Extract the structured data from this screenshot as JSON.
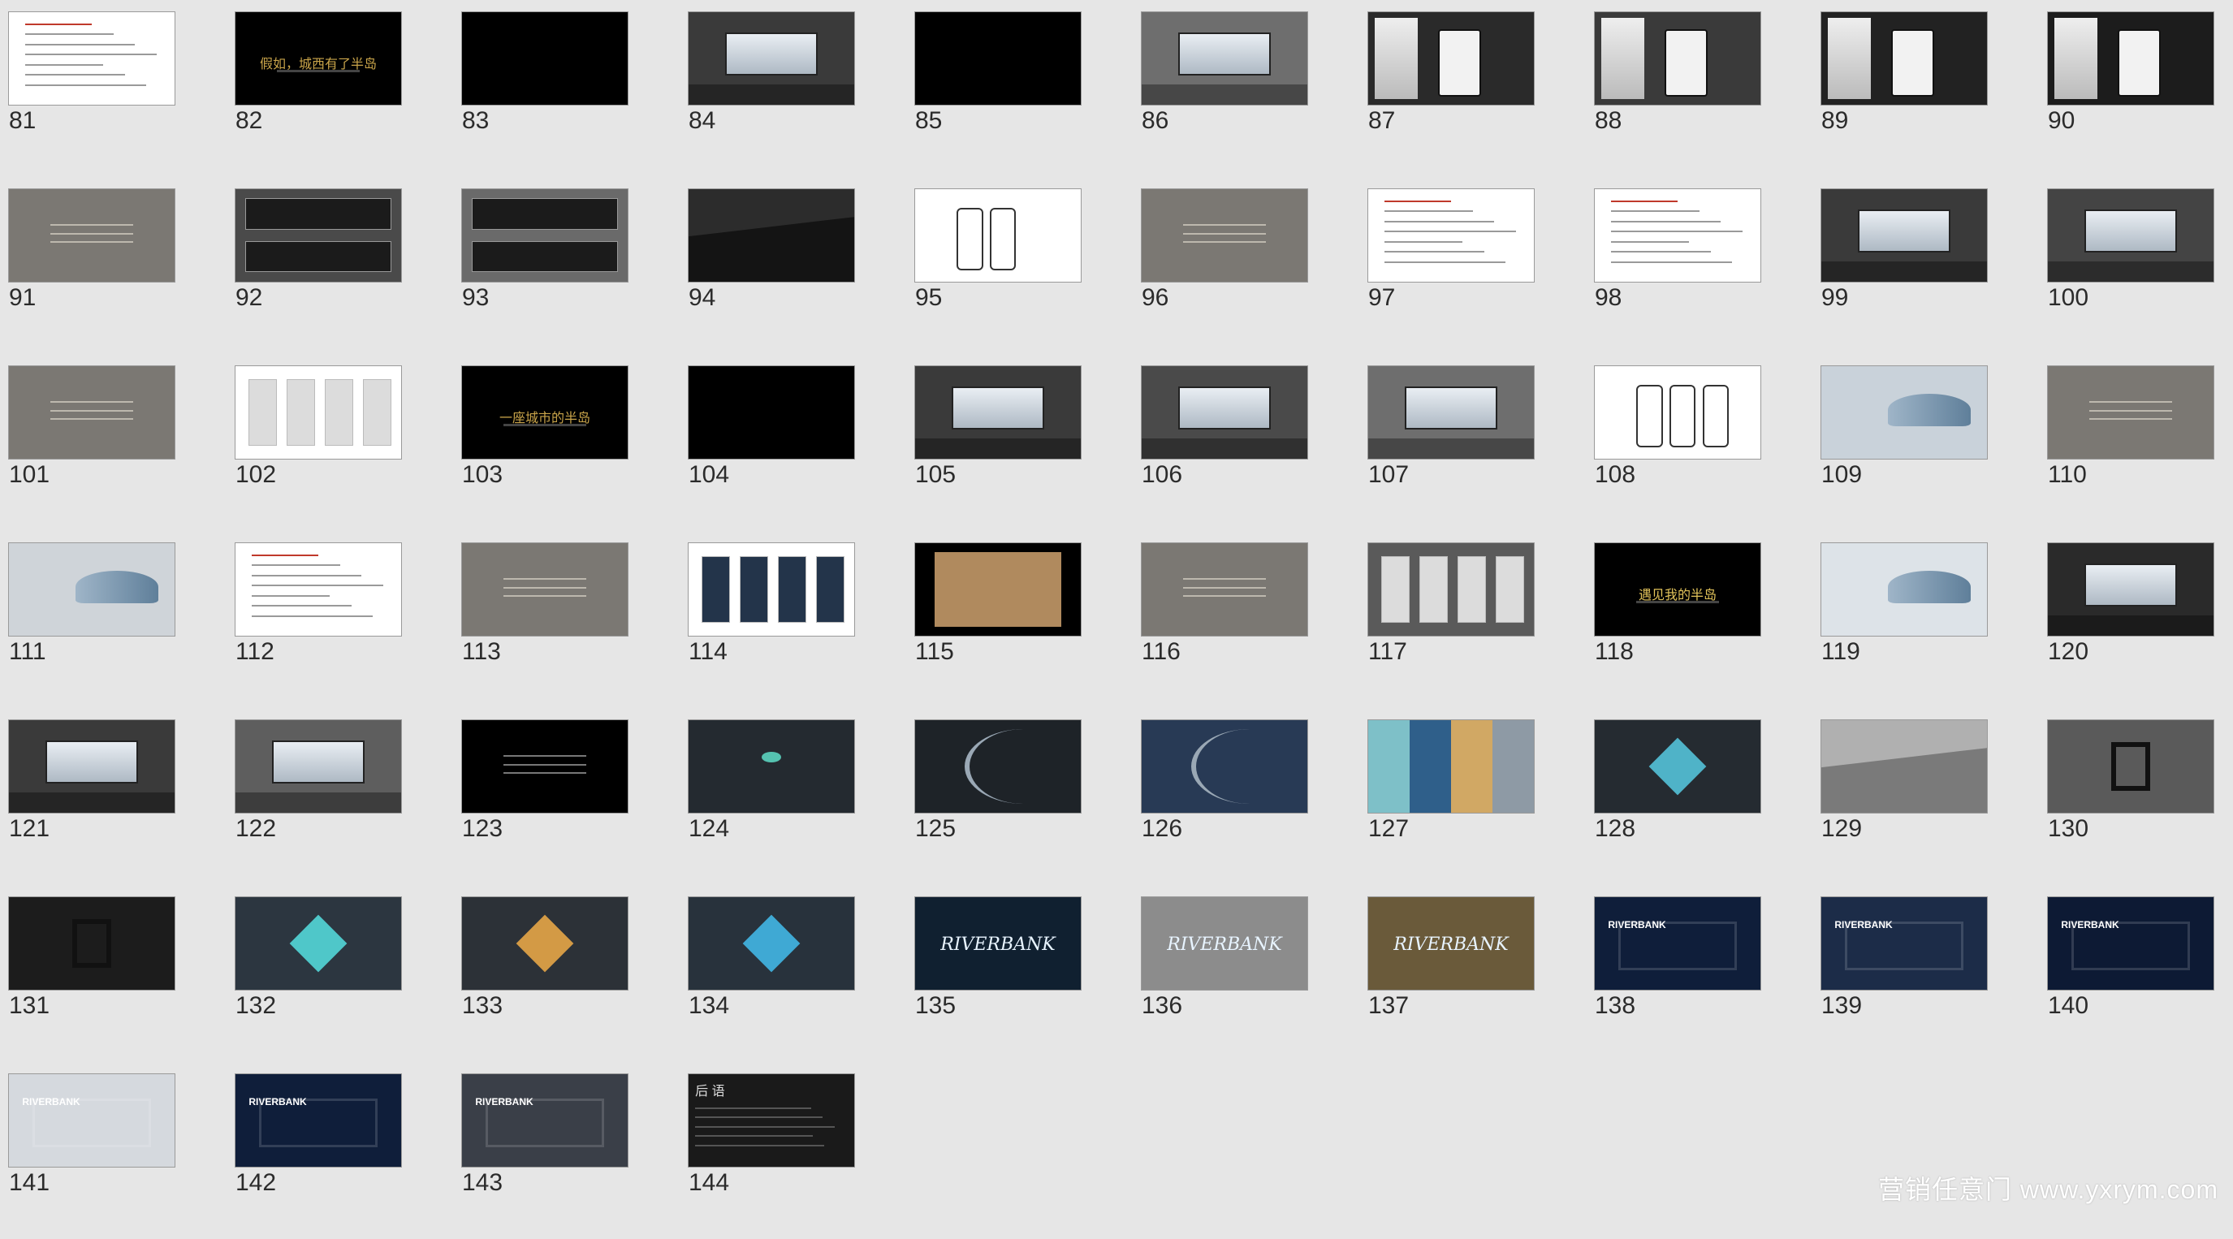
{
  "view": "slide-sorter",
  "colors": {
    "background": "#e6e6e6",
    "selected_border": "#9a9a9a"
  },
  "watermark": "营销任意门 www.yxrym.com",
  "slides": [
    {
      "n": "81",
      "bg": "#ffffff",
      "kind": "textdoc"
    },
    {
      "n": "82",
      "bg": "#000000",
      "kind": "caption",
      "caption": "假如，城西有了半岛",
      "caption_color": "#c9a44a"
    },
    {
      "n": "83",
      "bg": "#000000",
      "kind": "blank"
    },
    {
      "n": "84",
      "bg": "#3a3a3a",
      "kind": "billboard"
    },
    {
      "n": "85",
      "bg": "#000000",
      "kind": "blank"
    },
    {
      "n": "86",
      "bg": "#6e6e6e",
      "kind": "billboard"
    },
    {
      "n": "87",
      "bg": "#2a2a2a",
      "kind": "phone-hand"
    },
    {
      "n": "88",
      "bg": "#3a3a3a",
      "kind": "phone-hand"
    },
    {
      "n": "89",
      "bg": "#222222",
      "kind": "phone-hand"
    },
    {
      "n": "90",
      "bg": "#1c1c1c",
      "kind": "phone-hand"
    },
    {
      "n": "91",
      "bg": "#7b7873",
      "kind": "gray-text"
    },
    {
      "n": "92",
      "bg": "#4a4a4a",
      "kind": "banners"
    },
    {
      "n": "93",
      "bg": "#6a6a6a",
      "kind": "banners"
    },
    {
      "n": "94",
      "bg": "#2c2c2c",
      "kind": "building-dark"
    },
    {
      "n": "95",
      "bg": "#ffffff",
      "kind": "phones"
    },
    {
      "n": "96",
      "bg": "#7b7873",
      "kind": "gray-text"
    },
    {
      "n": "97",
      "bg": "#ffffff",
      "kind": "textdoc"
    },
    {
      "n": "98",
      "bg": "#ffffff",
      "kind": "textdoc"
    },
    {
      "n": "99",
      "bg": "#3a3a3a",
      "kind": "lightbox"
    },
    {
      "n": "100",
      "bg": "#444444",
      "kind": "lightbox"
    },
    {
      "n": "101",
      "bg": "#7b7873",
      "kind": "gray-text"
    },
    {
      "n": "102",
      "bg": "#ffffff",
      "kind": "posters"
    },
    {
      "n": "103",
      "bg": "#000000",
      "kind": "caption",
      "caption": "一座城市的半岛",
      "caption_color": "#c9a44a"
    },
    {
      "n": "104",
      "bg": "#000000",
      "kind": "blank"
    },
    {
      "n": "105",
      "bg": "#3a3a3a",
      "kind": "billboard"
    },
    {
      "n": "106",
      "bg": "#4a4a4a",
      "kind": "billboard"
    },
    {
      "n": "107",
      "bg": "#6e6e6e",
      "kind": "billboard"
    },
    {
      "n": "108",
      "bg": "#ffffff",
      "kind": "phones"
    },
    {
      "n": "109",
      "bg": "#c9d2da",
      "kind": "ad-light"
    },
    {
      "n": "110",
      "bg": "#7b7873",
      "kind": "gray-text"
    },
    {
      "n": "111",
      "bg": "#cfd4d9",
      "kind": "ad-light"
    },
    {
      "n": "112",
      "bg": "#ffffff",
      "kind": "textdoc"
    },
    {
      "n": "113",
      "bg": "#7b7873",
      "kind": "gray-text"
    },
    {
      "n": "114",
      "bg": "#ffffff",
      "kind": "posters-dark"
    },
    {
      "n": "115",
      "bg": "#000000",
      "kind": "floor"
    },
    {
      "n": "116",
      "bg": "#7b7873",
      "kind": "gray-text"
    },
    {
      "n": "117",
      "bg": "#5a5a5a",
      "kind": "posters"
    },
    {
      "n": "118",
      "bg": "#000000",
      "kind": "caption",
      "caption": "遇见我的半岛",
      "caption_color": "#e2c35a"
    },
    {
      "n": "119",
      "bg": "#dde3e8",
      "kind": "ad-light"
    },
    {
      "n": "120",
      "bg": "#2a2a2a",
      "kind": "billboard"
    },
    {
      "n": "121",
      "bg": "#3a3a3a",
      "kind": "billboard"
    },
    {
      "n": "122",
      "bg": "#5e5e5e",
      "kind": "billboard"
    },
    {
      "n": "123",
      "bg": "#000000",
      "kind": "gray-text"
    },
    {
      "n": "124",
      "bg": "#242a30",
      "kind": "logo-dark"
    },
    {
      "n": "125",
      "bg": "#1e2328",
      "kind": "swoosh"
    },
    {
      "n": "126",
      "bg": "#283a55",
      "kind": "swoosh"
    },
    {
      "n": "127",
      "bg": "#3f7fa0",
      "kind": "palette"
    },
    {
      "n": "128",
      "bg": "#252b31",
      "kind": "mark",
      "mark_color": "#4fb3c8"
    },
    {
      "n": "129",
      "bg": "#b0b0b0",
      "kind": "building-light"
    },
    {
      "n": "130",
      "bg": "#5a5a5a",
      "kind": "sculpture"
    },
    {
      "n": "131",
      "bg": "#1c1c1c",
      "kind": "sculpture"
    },
    {
      "n": "132",
      "bg": "#2c3640",
      "kind": "mark",
      "mark_color": "#4fc7c9"
    },
    {
      "n": "133",
      "bg": "#2c3137",
      "kind": "mark",
      "mark_color": "#d39a45"
    },
    {
      "n": "134",
      "bg": "#28323c",
      "kind": "mark",
      "mark_color": "#3fa9d4"
    },
    {
      "n": "135",
      "bg": "#102030",
      "kind": "brand",
      "brand": "RIVERBANK"
    },
    {
      "n": "136",
      "bg": "#8c8c8c",
      "kind": "brand",
      "brand": "RIVERBANK"
    },
    {
      "n": "137",
      "bg": "#6a5a3a",
      "kind": "brand",
      "brand": "RIVERBANK"
    },
    {
      "n": "138",
      "bg": "#0f1e3a",
      "kind": "brand-ad",
      "brand": "RIVERBANK"
    },
    {
      "n": "139",
      "bg": "#1c2c48",
      "kind": "brand-ad",
      "brand": "RIVERBANK"
    },
    {
      "n": "140",
      "bg": "#0d1a34",
      "kind": "brand-ad",
      "brand": "RIVERBANK"
    },
    {
      "n": "141",
      "bg": "#d5d9de",
      "kind": "brand-ad",
      "brand": "RIVERBANK"
    },
    {
      "n": "142",
      "bg": "#0f1e3a",
      "kind": "brand-ad",
      "brand": "RIVERBANK"
    },
    {
      "n": "143",
      "bg": "#3a3f48",
      "kind": "brand-ad",
      "brand": "RIVERBANK"
    },
    {
      "n": "144",
      "bg": "#1a1a1a",
      "kind": "epilogue",
      "heading": "后 语"
    }
  ]
}
